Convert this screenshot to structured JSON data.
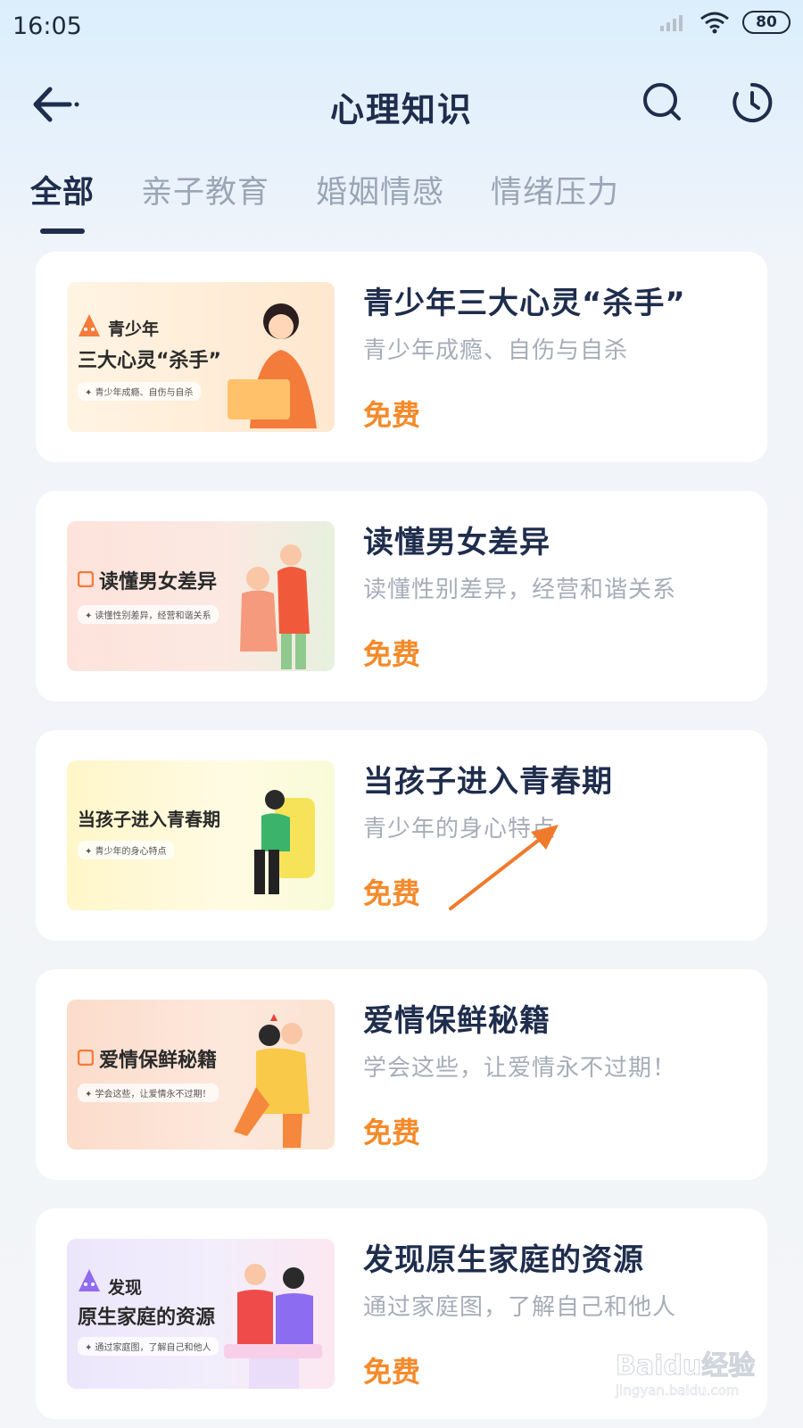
{
  "status_bar": {
    "time": "16:05",
    "battery": "80"
  },
  "nav": {
    "title": "心理知识"
  },
  "tabs": [
    {
      "label": "全部",
      "active": true
    },
    {
      "label": "亲子教育",
      "active": false
    },
    {
      "label": "婚姻情感",
      "active": false
    },
    {
      "label": "情绪压力",
      "active": false
    }
  ],
  "courses": [
    {
      "title": "青少年三大心灵“杀手”",
      "desc": "青少年成瘾、自伤与自杀",
      "price": "免费",
      "thumb": {
        "line1": "青少年",
        "line2": "三大心灵“杀手”",
        "sub": "✦ 青少年成瘾、自伤与自杀"
      }
    },
    {
      "title": "读懂男女差异",
      "desc": "读懂性别差异，经营和谐关系",
      "price": "免费",
      "thumb": {
        "line1": "",
        "line2": "读懂男女差异",
        "sub": "✦ 读懂性别差异，经营和谐关系"
      }
    },
    {
      "title": "当孩子进入青春期",
      "desc": "青少年的身心特点",
      "price": "免费",
      "thumb": {
        "line1": "",
        "line2": "当孩子进入青春期",
        "sub": "✦ 青少年的身心特点"
      }
    },
    {
      "title": "爱情保鲜秘籍",
      "desc": "学会这些，让爱情永不过期！",
      "price": "免费",
      "thumb": {
        "line1": "",
        "line2": "爱情保鲜秘籍",
        "sub": "✦ 学会这些，让爱情永不过期！"
      }
    },
    {
      "title": "发现原生家庭的资源",
      "desc": "通过家庭图，了解自己和他人",
      "price": "免费",
      "thumb": {
        "line1": "发现",
        "line2": "原生家庭的资源",
        "sub": "✦ 通过家庭图，了解自己和他人"
      }
    }
  ],
  "watermark": {
    "text": "Baidu经验",
    "url": "jingyan.baidu.com"
  },
  "colors": {
    "accent": "#f58a2a",
    "title": "#1f2d4d",
    "muted": "#a6adb9",
    "arrow": "#f07a2c"
  }
}
